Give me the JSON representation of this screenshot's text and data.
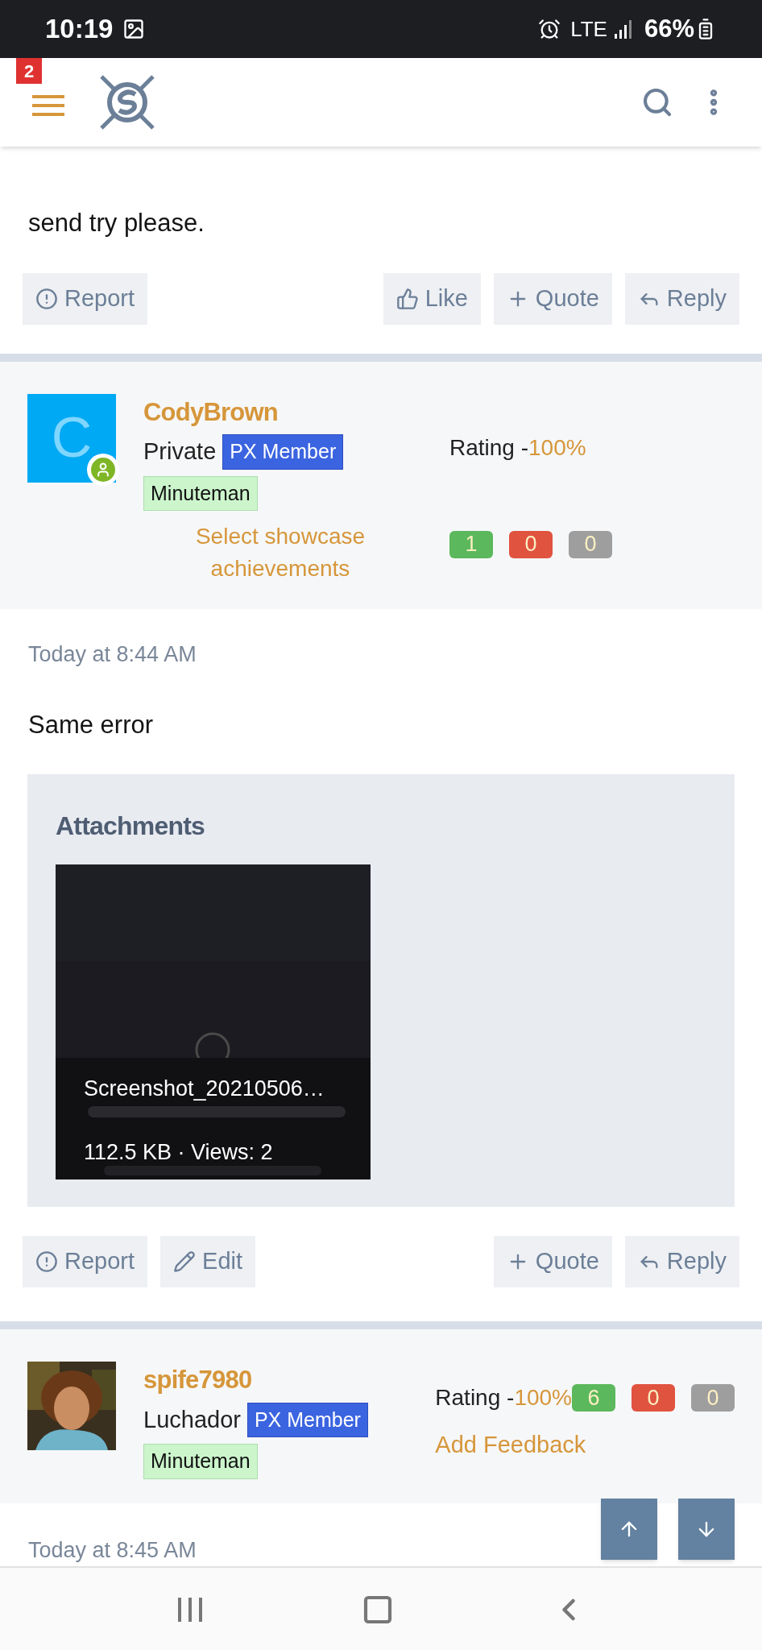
{
  "status_bar": {
    "time": "10:19",
    "network": "LTE",
    "battery": "66%"
  },
  "header": {
    "notification_count": "2"
  },
  "posts": [
    {
      "body": "send try please.",
      "actions": [
        {
          "kind": "report",
          "label": "Report"
        },
        {
          "kind": "like",
          "label": "Like"
        },
        {
          "kind": "quote",
          "label": "Quote"
        },
        {
          "kind": "reply",
          "label": "Reply"
        }
      ]
    },
    {
      "author": {
        "name": "CodyBrown",
        "avatar": {
          "kind": "letter",
          "letter": "C",
          "online": true
        },
        "rank": "Private",
        "badge": "PX Member",
        "tag": "Minuteman",
        "link": "Select showcase achievements",
        "rating_label": "Rating -",
        "rating_value": "100%",
        "counts": [
          {
            "value": "1",
            "color": "#5cb85c"
          },
          {
            "value": "0",
            "color": "#e0533f"
          },
          {
            "value": "0",
            "color": "#9e9e9e"
          }
        ]
      },
      "time": "Today at 8:44 AM",
      "body": "Same error",
      "attachments": {
        "title": "Attachments",
        "file_name": "Screenshot_20210506…",
        "meta": "112.5 KB · Views: 2"
      },
      "actions": [
        {
          "kind": "report",
          "label": "Report"
        },
        {
          "kind": "edit",
          "label": "Edit"
        },
        {
          "kind": "quote",
          "label": "Quote"
        },
        {
          "kind": "reply",
          "label": "Reply"
        }
      ]
    },
    {
      "author": {
        "name": "spife7980",
        "rank": "Luchador",
        "badge": "PX Member",
        "tag": "Minuteman",
        "link": "Add Feedback",
        "rating_label": "Rating -",
        "rating_value": "100%",
        "counts": [
          {
            "value": "6",
            "color": "#5cb85c"
          },
          {
            "value": "0",
            "color": "#e0533f"
          },
          {
            "value": "0",
            "color": "#9e9e9e"
          }
        ]
      },
      "time": "Today at 8:45 AM"
    }
  ]
}
